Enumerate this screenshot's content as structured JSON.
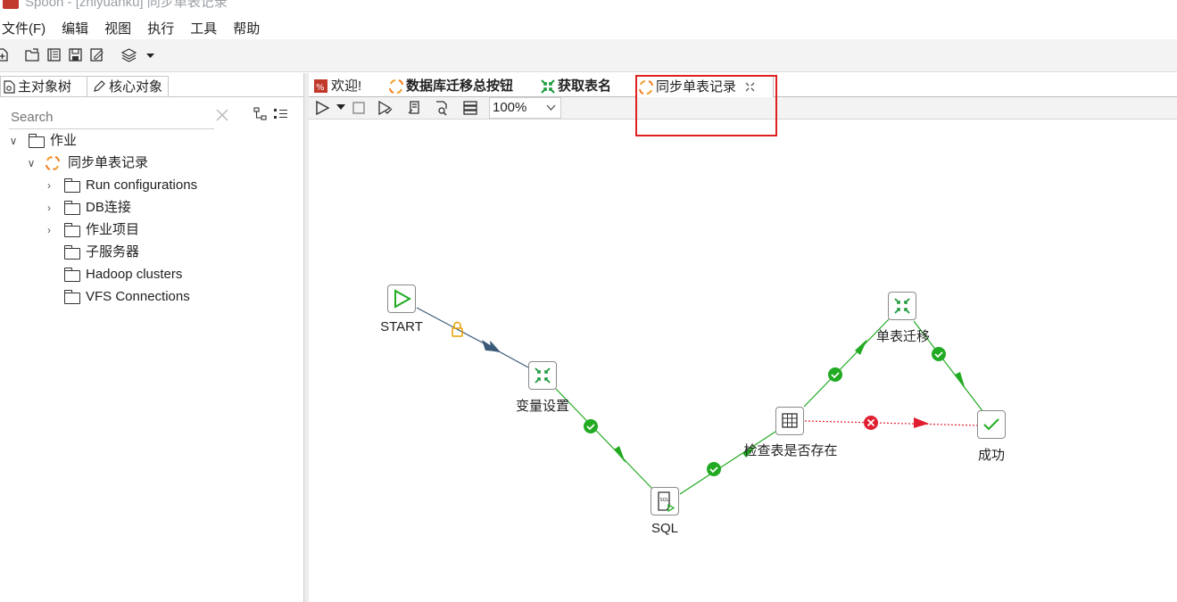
{
  "window": {
    "title": "Spoon - [zhiyuanku] 同步单表记录"
  },
  "menu": [
    "文件(F)",
    "编辑",
    "视图",
    "执行",
    "工具",
    "帮助"
  ],
  "left_panel": {
    "tabs": [
      "主对象树",
      "核心对象"
    ],
    "search": {
      "placeholder": "Search"
    },
    "tree": {
      "root": "作业",
      "job": "同步单表记录",
      "children": [
        "Run configurations",
        "DB连接",
        "作业项目",
        "子服务器",
        "Hadoop clusters",
        "VFS Connections"
      ]
    }
  },
  "editor_tabs": [
    {
      "label": "欢迎!",
      "bold": false
    },
    {
      "label": "数据库迁移总按钮",
      "bold": true
    },
    {
      "label": "获取表名",
      "bold": true
    },
    {
      "label": "同步单表记录",
      "bold": false,
      "active": true
    }
  ],
  "canvas_toolbar": {
    "zoom": "100%"
  },
  "job_entries": [
    {
      "id": "start",
      "label": "START",
      "icon": "start-icon"
    },
    {
      "id": "vars",
      "label": "变量设置",
      "icon": "transform-icon"
    },
    {
      "id": "sql",
      "label": "SQL",
      "icon": "sql-icon"
    },
    {
      "id": "check",
      "label": "检查表是否存在",
      "icon": "table-icon"
    },
    {
      "id": "migrate",
      "label": "单表迁移",
      "icon": "transform-icon"
    },
    {
      "id": "success",
      "label": "成功",
      "icon": "checkmark-icon"
    }
  ],
  "hops": [
    {
      "from": "start",
      "to": "vars",
      "type": "unconditional",
      "badge": "lock-icon"
    },
    {
      "from": "vars",
      "to": "sql",
      "type": "success",
      "badge": "check-icon"
    },
    {
      "from": "sql",
      "to": "check",
      "type": "success",
      "badge": "check-icon"
    },
    {
      "from": "check",
      "to": "migrate",
      "type": "success",
      "badge": "check-icon"
    },
    {
      "from": "migrate",
      "to": "success",
      "type": "success",
      "badge": "check-icon"
    },
    {
      "from": "check",
      "to": "success",
      "type": "failure",
      "badge": "error-icon"
    }
  ],
  "colors": {
    "success": "#22aa22",
    "failure": "#e02030",
    "unconditional": "#3a5a78",
    "highlight": "#e02020",
    "lock": "#e8a000"
  }
}
